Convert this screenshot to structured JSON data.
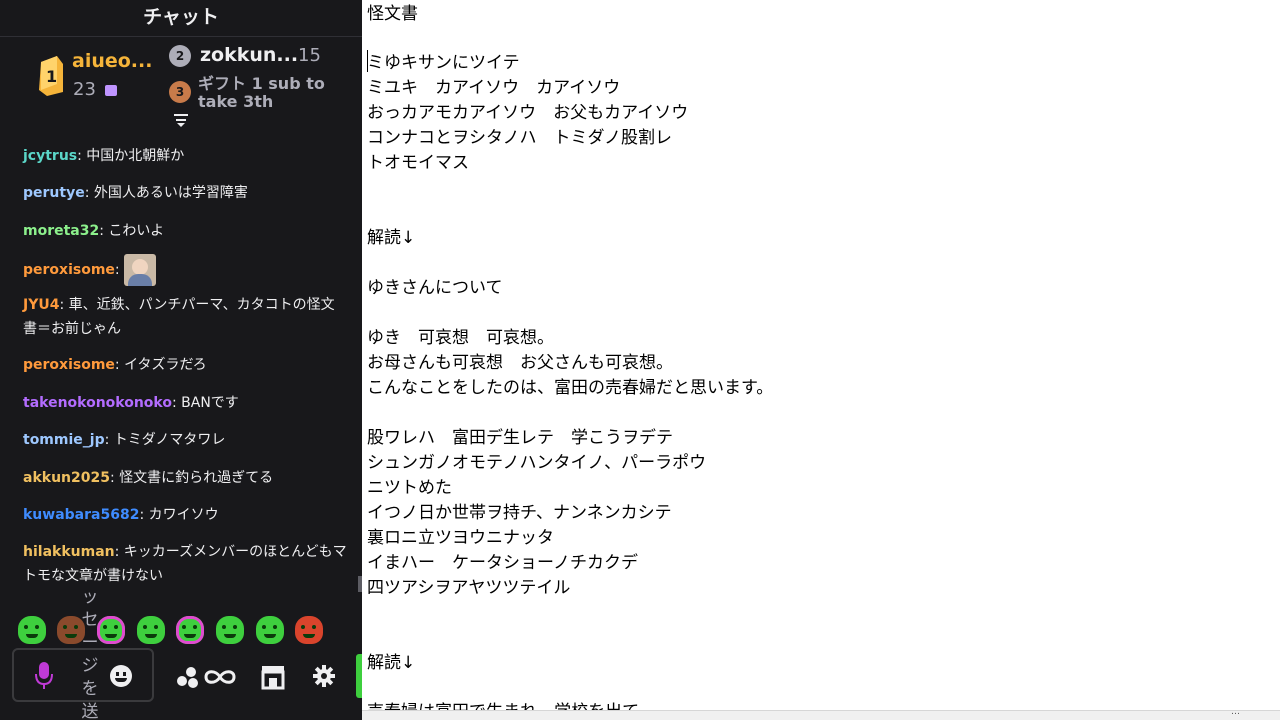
{
  "chat": {
    "title": "チャット",
    "leaderboard": {
      "first": {
        "rank_icon": "crown-icon",
        "name": "aiueo...",
        "count": "23",
        "unit_icon": "bits-gem-icon"
      },
      "second": {
        "rank": "2",
        "name": "zokkun...",
        "count": "15"
      },
      "third": {
        "rank": "3",
        "gift_text": "ギフト 1 sub to take 3th"
      }
    },
    "messages": [
      {
        "user": "jcytrus",
        "color": "#5bd6c8",
        "text": "中国か北朝鮮か"
      },
      {
        "user": "perutye",
        "color": "#9ec8ff",
        "text": "外国人あるいは学習障害"
      },
      {
        "user": "moreta32",
        "color": "#8cf08c",
        "text": "こわいよ"
      },
      {
        "user": "peroxisome",
        "color": "#ff9a3c",
        "text": "",
        "emote": "photo-emote"
      },
      {
        "user": "JYU4",
        "color": "#ff9a3c",
        "text": "車、近鉄、パンチパーマ、カタコトの怪文書＝お前じゃん"
      },
      {
        "user": "peroxisome",
        "color": "#ff9a3c",
        "text": "イタズラだろ"
      },
      {
        "user": "takenokonokonoko",
        "color": "#b36cff",
        "text": "BANです"
      },
      {
        "user": "tommie_jp",
        "color": "#9ec8ff",
        "text": "トミダノマタワレ"
      },
      {
        "user": "akkun2025",
        "color": "#f0c060",
        "text": "怪文書に釣られ過ぎてる"
      },
      {
        "user": "kuwabara5682",
        "color": "#3f8cff",
        "text": "カワイソウ"
      },
      {
        "user": "hilakkuman",
        "color": "#f0c060",
        "text": "キッカーズメンバーのほとんどもマトモな文章が書けない"
      }
    ],
    "input_placeholder_vertical": "ッセージを送",
    "emotes": [
      "frog-emote",
      "bear-emote",
      "frog-headphones-emote",
      "frog-emote",
      "frog-headphones-emote",
      "frog-emote",
      "frog-emote",
      "mushroom-emote"
    ]
  },
  "document": {
    "lines": [
      "怪文書",
      "",
      "ミゆキサンにツイテ",
      "ミユキ　カアイソウ　カアイソウ",
      "おっカアモカアイソウ　お父もカアイソウ",
      "コンナコとヲシタノハ　トミダノ股割レ",
      "トオモイマス",
      "",
      "",
      "解読↓",
      "",
      "ゆきさんについて",
      "",
      "ゆき　可哀想　可哀想。",
      "お母さんも可哀想　お父さんも可哀想。",
      "こんなことをしたのは、富田の売春婦だと思います。",
      "",
      "股ワレハ　富田デ生レテ　学こうヲデテ",
      "シュンガノオモテノハンタイノ、パーラポウ",
      "ニツトめた",
      "イつノ日か世帯ヲ持チ、ナンネンカシテ",
      "裏ロニ立ツヨウニナッタ",
      "イまハー　ケータショーノチカクデ",
      "四ツアシヲアヤツツテイル",
      "",
      "",
      "解読↓",
      "",
      "売春婦は富田で生まれ、学校を出て"
    ],
    "status": "…"
  }
}
